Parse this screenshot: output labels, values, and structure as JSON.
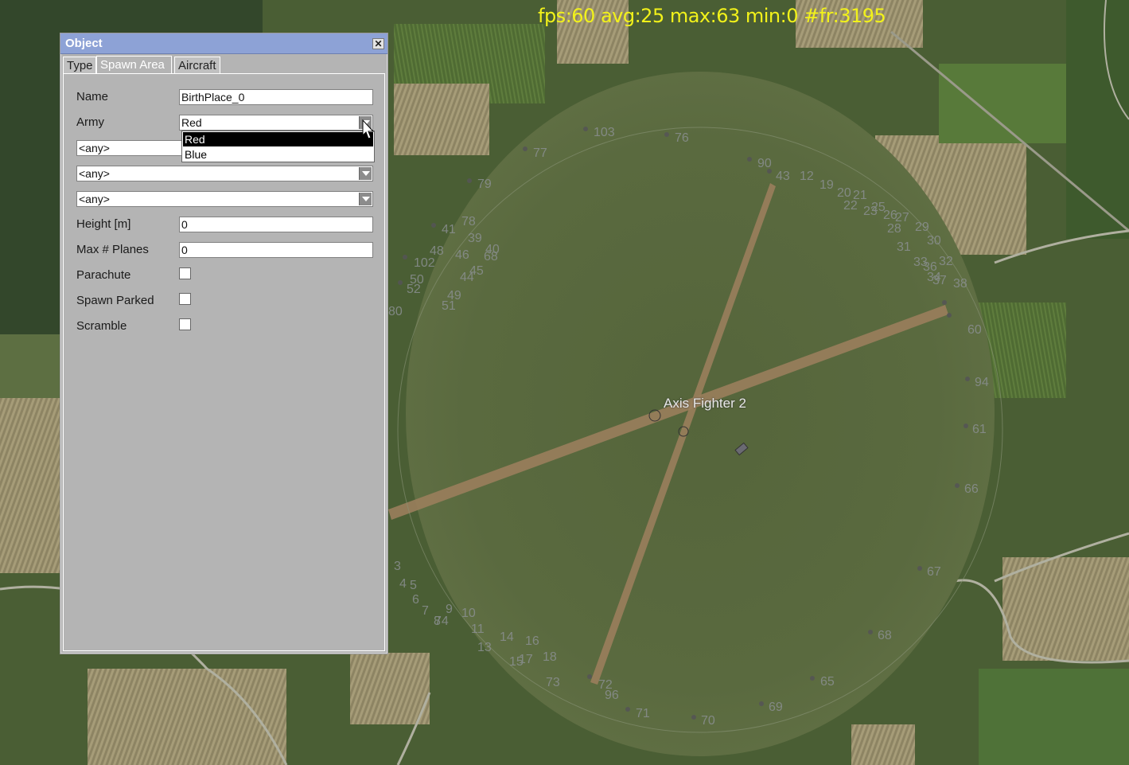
{
  "hud": {
    "fps_text": "fps:60 avg:25 max:63 min:0 #fr:3195"
  },
  "map": {
    "airfield_label": "Axis Fighter 2",
    "waypoint_labels": [
      "103",
      "76",
      "77",
      "79",
      "90",
      "43",
      "78",
      "41",
      "48",
      "39",
      "40",
      "102",
      "46",
      "45",
      "44",
      "68",
      "50",
      "52",
      "49",
      "51",
      "80",
      "12",
      "19",
      "20",
      "21",
      "22",
      "23",
      "25",
      "26",
      "27",
      "28",
      "29",
      "30",
      "31",
      "32",
      "33",
      "34",
      "36",
      "37",
      "38",
      "60",
      "94",
      "61",
      "66",
      "67",
      "68",
      "65",
      "69",
      "70",
      "71",
      "96",
      "72",
      "73",
      "18",
      "16",
      "17",
      "15",
      "14",
      "13",
      "11",
      "10",
      "9",
      "8",
      "7",
      "6",
      "5",
      "4",
      "3",
      "74",
      "75"
    ],
    "colors": {
      "runway": "#9a7e5c",
      "grass": "#55653b",
      "hud": "#f2f21a"
    }
  },
  "dialog": {
    "title": "Object",
    "close_icon": "close-icon",
    "tabs": [
      {
        "label": "Type",
        "active": false
      },
      {
        "label": "Spawn Area",
        "active": true
      },
      {
        "label": "Aircraft",
        "active": false
      }
    ],
    "fields": {
      "name": {
        "label": "Name",
        "value": "BirthPlace_0"
      },
      "army": {
        "label": "Army",
        "value": "Red",
        "options": [
          "Red",
          "Blue"
        ],
        "highlighted": "Red"
      },
      "filter1": {
        "value": "<any>"
      },
      "filter2": {
        "value": "<any>"
      },
      "filter3": {
        "value": "<any>"
      },
      "height": {
        "label": "Height [m]",
        "value": "0"
      },
      "max_planes": {
        "label": "Max # Planes",
        "value": "0"
      },
      "parachute": {
        "label": "Parachute",
        "checked": false
      },
      "spawn_parked": {
        "label": "Spawn Parked",
        "checked": false
      },
      "scramble": {
        "label": "Scramble",
        "checked": false
      }
    }
  }
}
